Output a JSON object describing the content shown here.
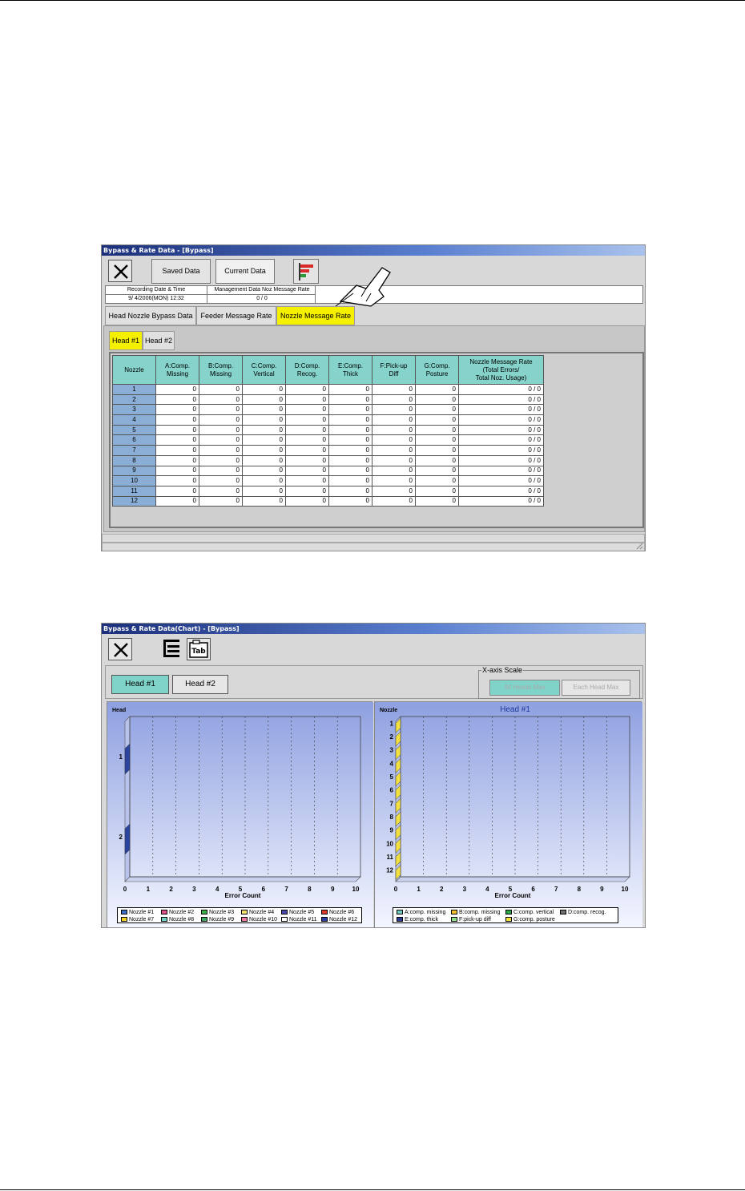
{
  "window1": {
    "title": "Bypass & Rate Data - [Bypass]",
    "toolbar": {
      "saved_data": "Saved Data",
      "current_data": "Current Data"
    },
    "info": {
      "recording_label": "Recording Date & Time",
      "recording_value": "9/ 4/2006(MON) 12:32",
      "mgmt_label": "Management Data Noz Message Rate",
      "mgmt_value": "0 / 0"
    },
    "tabs": [
      "Head Nozzle Bypass Data",
      "Feeder Message Rate",
      "Nozzle Message Rate"
    ],
    "active_tab": "Nozzle Message Rate",
    "head_tabs": [
      "Head #1",
      "Head #2"
    ],
    "table": {
      "headers": [
        [
          "Nozzle"
        ],
        [
          "A:Comp.",
          "Missing"
        ],
        [
          "B:Comp.",
          "Missing"
        ],
        [
          "C:Comp.",
          "Vertical"
        ],
        [
          "D:Comp.",
          "Recog."
        ],
        [
          "E:Comp.",
          "Thick"
        ],
        [
          "F:Pick-up",
          "Diff"
        ],
        [
          "G:Comp.",
          "Posture"
        ],
        [
          "Nozzle Message Rate",
          "(Total Errors/",
          "Total Noz. Usage)"
        ]
      ],
      "rows": [
        [
          "1",
          "0",
          "0",
          "0",
          "0",
          "0",
          "0",
          "0",
          "0 / 0"
        ],
        [
          "2",
          "0",
          "0",
          "0",
          "0",
          "0",
          "0",
          "0",
          "0 / 0"
        ],
        [
          "3",
          "0",
          "0",
          "0",
          "0",
          "0",
          "0",
          "0",
          "0 / 0"
        ],
        [
          "4",
          "0",
          "0",
          "0",
          "0",
          "0",
          "0",
          "0",
          "0 / 0"
        ],
        [
          "5",
          "0",
          "0",
          "0",
          "0",
          "0",
          "0",
          "0",
          "0 / 0"
        ],
        [
          "6",
          "0",
          "0",
          "0",
          "0",
          "0",
          "0",
          "0",
          "0 / 0"
        ],
        [
          "7",
          "0",
          "0",
          "0",
          "0",
          "0",
          "0",
          "0",
          "0 / 0"
        ],
        [
          "8",
          "0",
          "0",
          "0",
          "0",
          "0",
          "0",
          "0",
          "0 / 0"
        ],
        [
          "9",
          "0",
          "0",
          "0",
          "0",
          "0",
          "0",
          "0",
          "0 / 0"
        ],
        [
          "10",
          "0",
          "0",
          "0",
          "0",
          "0",
          "0",
          "0",
          "0 / 0"
        ],
        [
          "11",
          "0",
          "0",
          "0",
          "0",
          "0",
          "0",
          "0",
          "0 / 0"
        ],
        [
          "12",
          "0",
          "0",
          "0",
          "0",
          "0",
          "0",
          "0",
          "0 / 0"
        ]
      ]
    }
  },
  "window2": {
    "title": "Bypass & Rate Data(Chart) - [Bypass]",
    "head_buttons": [
      "Head #1",
      "Head #2"
    ],
    "xaxis_scale": {
      "label": "X-axis Scale",
      "all_heads_max": "All Heads Max",
      "each_head_max": "Each Head Max"
    }
  },
  "colors": {
    "cyan_header": "#86d3cb",
    "nozzle_cell": "#8aaed6",
    "active_tab": "#f5f000",
    "plot_top": "#8ea0e0",
    "plot_bottom": "#f4f6ff"
  },
  "chart_data": [
    {
      "type": "bar",
      "orientation": "horizontal",
      "stacked": true,
      "ylabel": "Head",
      "xlabel": "Error Count",
      "categories": [
        "1",
        "2"
      ],
      "xlim": [
        0,
        10
      ],
      "xticks": [
        "0",
        "1",
        "2",
        "3",
        "4",
        "5",
        "6",
        "7",
        "8",
        "9",
        "10"
      ],
      "series": [
        {
          "name": "Nozzle #1",
          "color": "#3a6fc4",
          "values": [
            0,
            0
          ]
        },
        {
          "name": "Nozzle #2",
          "color": "#e0508a",
          "values": [
            0,
            0
          ]
        },
        {
          "name": "Nozzle #3",
          "color": "#3fae4a",
          "values": [
            0,
            0
          ]
        },
        {
          "name": "Nozzle #4",
          "color": "#f2e06a",
          "values": [
            0,
            0
          ]
        },
        {
          "name": "Nozzle #5",
          "color": "#4a4aa8",
          "values": [
            0,
            0
          ]
        },
        {
          "name": "Nozzle #6",
          "color": "#e03a2a",
          "values": [
            0,
            0
          ]
        },
        {
          "name": "Nozzle #7",
          "color": "#f0d020",
          "values": [
            0,
            0
          ]
        },
        {
          "name": "Nozzle #8",
          "color": "#70d0c4",
          "values": [
            0,
            0
          ]
        },
        {
          "name": "Nozzle #9",
          "color": "#3aa860",
          "values": [
            0,
            0
          ]
        },
        {
          "name": "Nozzle #10",
          "color": "#f07aa0",
          "values": [
            0,
            0
          ]
        },
        {
          "name": "Nozzle #11",
          "color": "#ffffff",
          "values": [
            0,
            0
          ]
        },
        {
          "name": "Nozzle #12",
          "color": "#2a3ea0",
          "values": [
            0,
            0
          ]
        }
      ],
      "grid": true,
      "legend": "bottom"
    },
    {
      "type": "bar",
      "orientation": "horizontal",
      "stacked": true,
      "title": "Head #1",
      "ylabel": "Nozzle",
      "xlabel": "Error Count",
      "categories": [
        "1",
        "2",
        "3",
        "4",
        "5",
        "6",
        "7",
        "8",
        "9",
        "10",
        "11",
        "12"
      ],
      "xlim": [
        0,
        10
      ],
      "xticks": [
        "0",
        "1",
        "2",
        "3",
        "4",
        "5",
        "6",
        "7",
        "8",
        "9",
        "10"
      ],
      "series": [
        {
          "name": "A:comp. missing",
          "color": "#6fc7c0",
          "values": [
            0,
            0,
            0,
            0,
            0,
            0,
            0,
            0,
            0,
            0,
            0,
            0
          ]
        },
        {
          "name": "B:comp. missing",
          "color": "#f0c030",
          "values": [
            0,
            0,
            0,
            0,
            0,
            0,
            0,
            0,
            0,
            0,
            0,
            0
          ]
        },
        {
          "name": "C:comp. vertical",
          "color": "#2ea84a",
          "values": [
            0,
            0,
            0,
            0,
            0,
            0,
            0,
            0,
            0,
            0,
            0,
            0
          ]
        },
        {
          "name": "D:comp. recog.",
          "color": "#707070",
          "values": [
            0,
            0,
            0,
            0,
            0,
            0,
            0,
            0,
            0,
            0,
            0,
            0
          ]
        },
        {
          "name": "E:comp. thick",
          "color": "#2a3a90",
          "values": [
            0,
            0,
            0,
            0,
            0,
            0,
            0,
            0,
            0,
            0,
            0,
            0
          ]
        },
        {
          "name": "F:pick-up diff",
          "color": "#90e08a",
          "values": [
            0,
            0,
            0,
            0,
            0,
            0,
            0,
            0,
            0,
            0,
            0,
            0
          ]
        },
        {
          "name": "G:comp. posture",
          "color": "#f2e040",
          "values": [
            0,
            0,
            0,
            0,
            0,
            0,
            0,
            0,
            0,
            0,
            0,
            0
          ]
        }
      ],
      "grid": true,
      "legend": "bottom"
    }
  ]
}
